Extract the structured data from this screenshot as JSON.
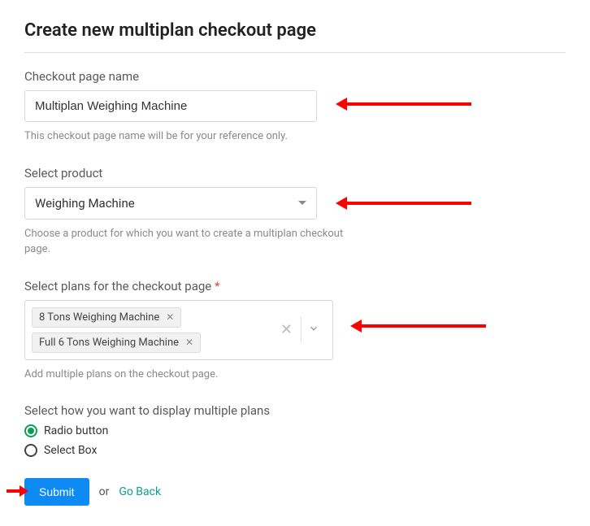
{
  "page": {
    "title": "Create new multiplan checkout page"
  },
  "name_field": {
    "label": "Checkout page name",
    "value": "Multiplan Weighing Machine",
    "helper": "This checkout page name will be for your reference only."
  },
  "product_field": {
    "label": "Select product",
    "value": "Weighing Machine",
    "helper": "Choose a product for which you want to create a multiplan checkout page."
  },
  "plans_field": {
    "label": "Select plans for the checkout page",
    "required": "*",
    "chips": [
      "8 Tons Weighing Machine",
      "Full 6 Tons Weighing Machine"
    ],
    "helper": "Add multiple plans on the checkout page."
  },
  "display_field": {
    "label": "Select how you want to display multiple plans",
    "options": [
      {
        "label": "Radio button",
        "selected": true
      },
      {
        "label": "Select Box",
        "selected": false
      }
    ]
  },
  "actions": {
    "submit": "Submit",
    "or": "or",
    "go_back": "Go Back"
  }
}
